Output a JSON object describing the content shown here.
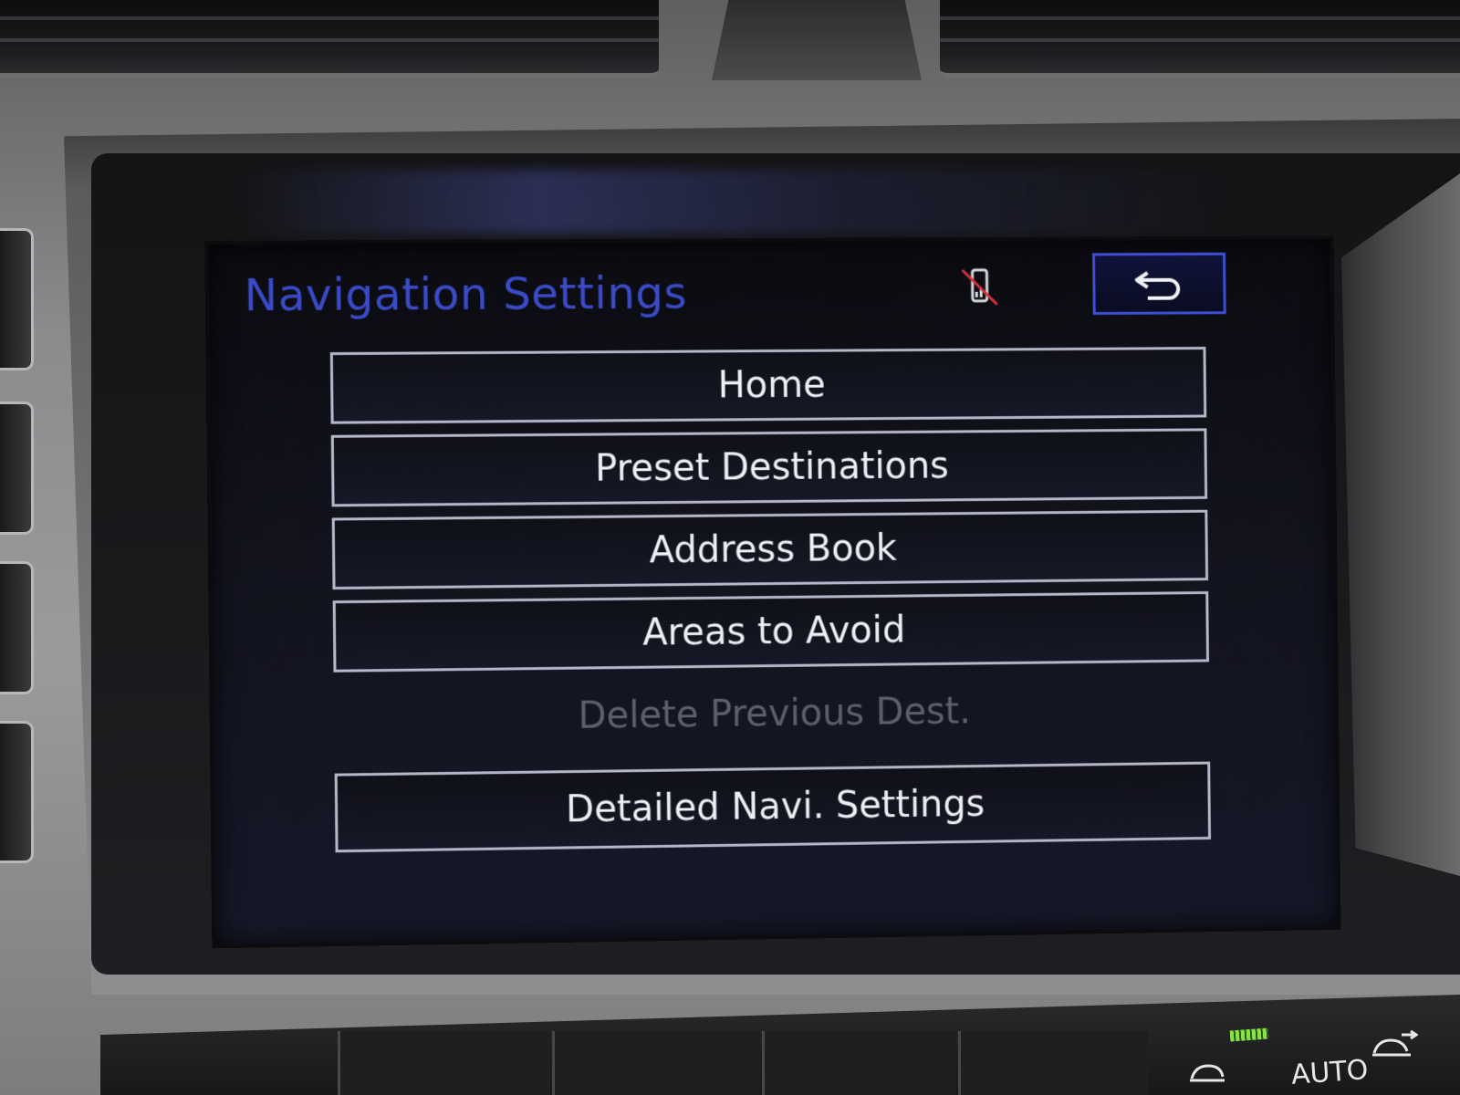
{
  "screen": {
    "title": "Navigation Settings",
    "status_icon": "phone-disconnected-icon",
    "back_icon": "back-arrow-icon"
  },
  "menu": {
    "items": [
      {
        "label": "Home",
        "enabled": true
      },
      {
        "label": "Preset Destinations",
        "enabled": true
      },
      {
        "label": "Address Book",
        "enabled": true
      },
      {
        "label": "Areas to Avoid",
        "enabled": true
      },
      {
        "label": "Delete Previous Dest.",
        "enabled": false
      },
      {
        "label": "Detailed Navi. Settings",
        "enabled": true
      }
    ]
  },
  "climate": {
    "auto_label": "AUTO",
    "icons": [
      "air-recirculation-icon",
      "fresh-air-icon"
    ]
  },
  "colors": {
    "title": "#3b4ac7",
    "button_border": "#b5b8c8",
    "button_text": "#eef0f5",
    "disabled_text": "#5d6068",
    "back_button_border": "#3d4fd2",
    "status_icon_slash": "#d8303a"
  }
}
